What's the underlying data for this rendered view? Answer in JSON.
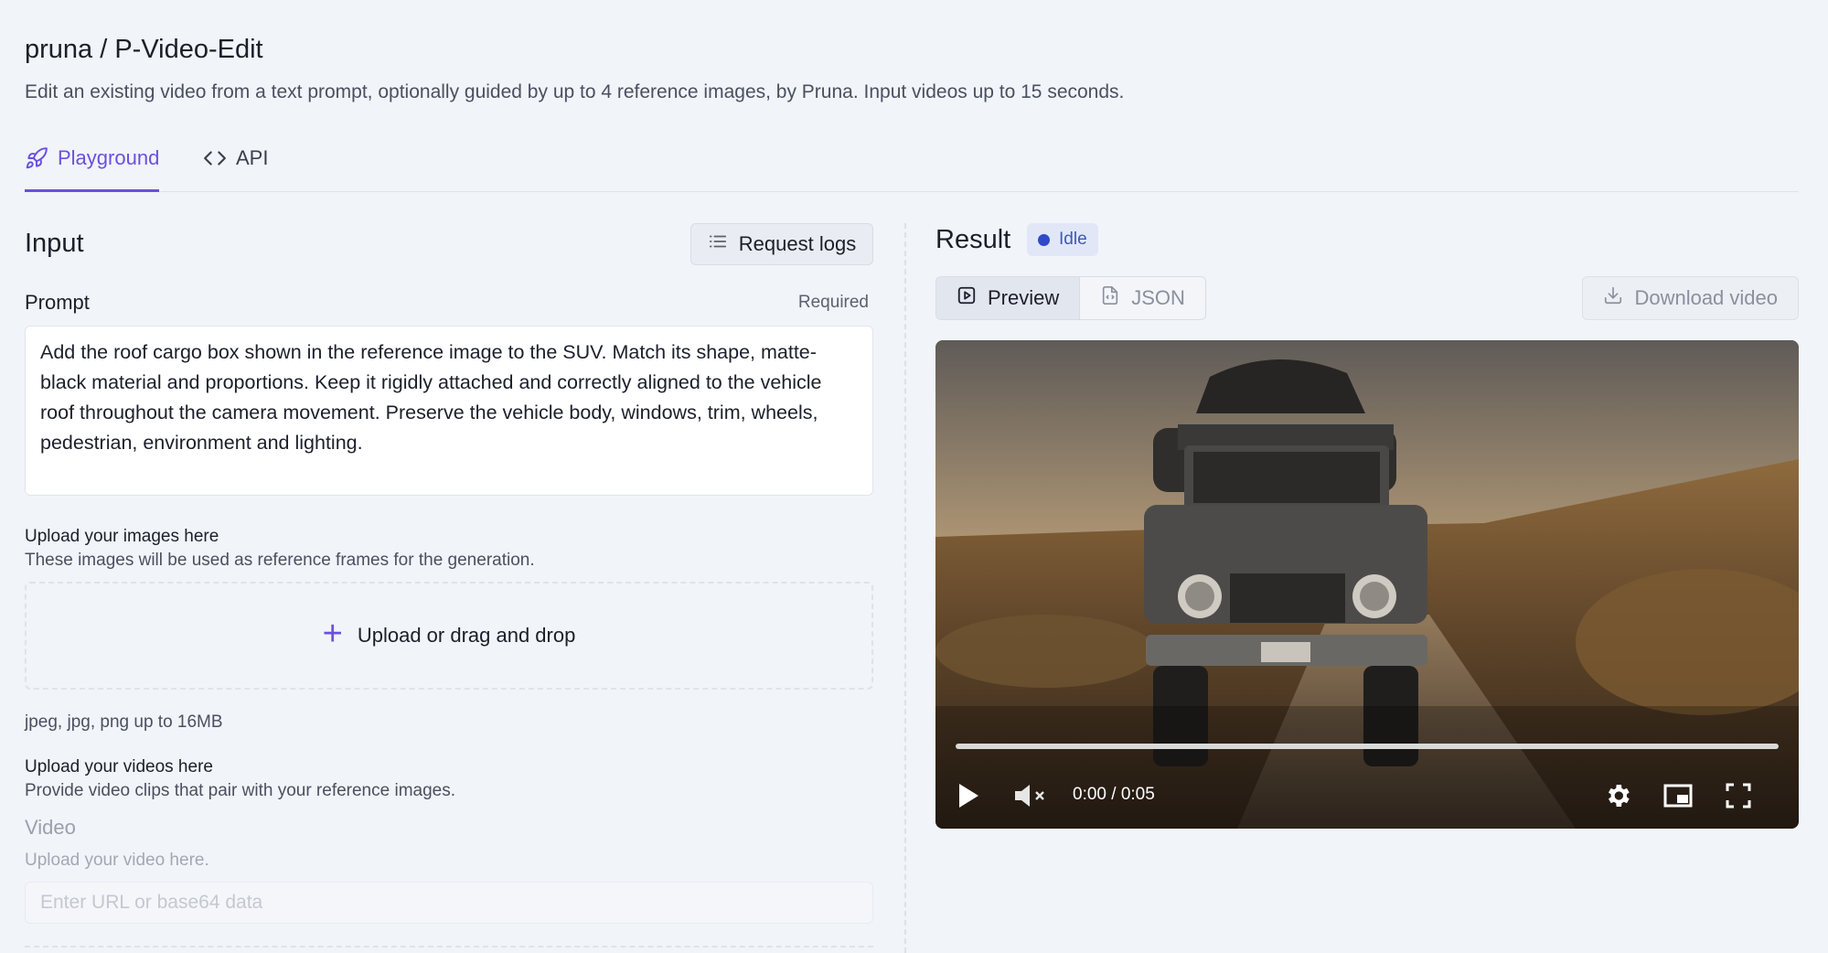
{
  "header": {
    "title": "pruna / P-Video-Edit",
    "subtitle": "Edit an existing video from a text prompt, optionally guided by up to 4 reference images, by Pruna. Input videos up to 15 seconds."
  },
  "tabs": [
    {
      "label": "Playground",
      "icon": "rocket-icon",
      "active": true
    },
    {
      "label": "API",
      "icon": "code-icon",
      "active": false
    }
  ],
  "input": {
    "heading": "Input",
    "request_logs_label": "Request logs",
    "prompt_label": "Prompt",
    "prompt_required": "Required",
    "prompt_value": "Add the roof cargo box shown in the reference image to the SUV. Match its shape, matte-black material and proportions. Keep it rigidly attached and correctly aligned to the vehicle roof throughout the camera movement. Preserve the vehicle body, windows, trim, wheels, pedestrian, environment and lighting.",
    "images": {
      "title": "Upload your images here",
      "description": "These images will be used as reference frames for the generation.",
      "dropzone_label": "Upload or drag and drop",
      "formats": "jpeg, jpg, png up to 16MB"
    },
    "videos": {
      "title": "Upload your videos here",
      "description": "Provide video clips that pair with your reference images.",
      "field_label": "Video",
      "field_hint": "Upload your video here.",
      "url_placeholder": "Enter URL or base64 data"
    }
  },
  "result": {
    "heading": "Result",
    "status": "Idle",
    "status_color": "#2f49c9",
    "view_tabs": [
      {
        "label": "Preview",
        "icon": "play-square-icon",
        "active": true
      },
      {
        "label": "JSON",
        "icon": "file-code-icon",
        "active": false
      }
    ],
    "download_label": "Download video",
    "player": {
      "time": "0:00 / 0:05",
      "progress": 0,
      "muted": true
    }
  },
  "colors": {
    "accent": "#6b4fe0",
    "background": "#f1f4f9"
  }
}
